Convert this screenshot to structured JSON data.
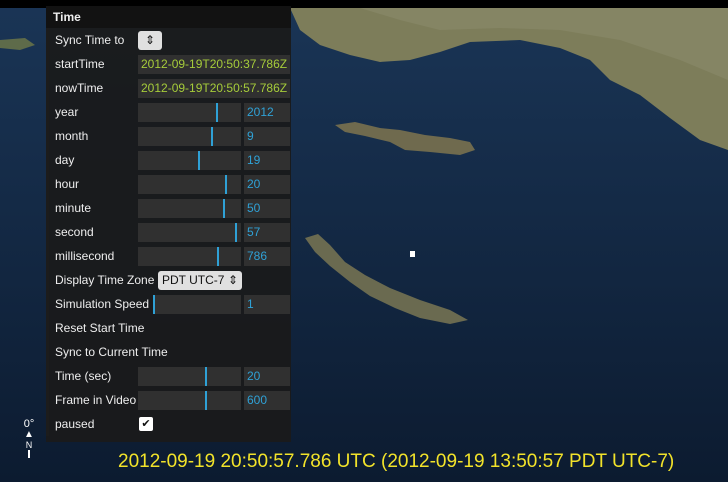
{
  "panel": {
    "title": "Time",
    "sync_time_label": "Sync Time to",
    "start_time": {
      "label": "startTime",
      "value": "2012-09-19T20:50:37.786Z"
    },
    "now_time": {
      "label": "nowTime",
      "value": "2012-09-19T20:50:57.786Z"
    },
    "sliders": [
      {
        "key": "year",
        "label": "year",
        "value": "2012",
        "level": 0.77
      },
      {
        "key": "month",
        "label": "month",
        "value": "9",
        "level": 0.72
      },
      {
        "key": "day",
        "label": "day",
        "value": "19",
        "level": 0.59
      },
      {
        "key": "hour",
        "label": "hour",
        "value": "20",
        "level": 0.86
      },
      {
        "key": "minute",
        "label": "minute",
        "value": "50",
        "level": 0.84
      },
      {
        "key": "second",
        "label": "second",
        "value": "57",
        "level": 0.96
      },
      {
        "key": "millisecond",
        "label": "millisecond",
        "value": "786",
        "level": 0.78
      }
    ],
    "display_time_zone": {
      "label": "Display Time Zone",
      "value": "PDT UTC-7"
    },
    "simulation_speed": {
      "label": "Simulation Speed",
      "value": "1",
      "level": 0.0
    },
    "reset_start_time": "Reset Start Time",
    "sync_current_time": "Sync to Current Time",
    "time_sec": {
      "label": "Time (sec)",
      "value": "20",
      "level": 0.66
    },
    "frame_in_video": {
      "label": "Frame in Video",
      "value": "600",
      "level": 0.66
    },
    "paused": {
      "label": "paused",
      "checked": true
    }
  },
  "status_text": "2012-09-19 20:50:57.786 UTC  (2012-09-19 13:50:57 PDT UTC-7)",
  "compass": {
    "heading": "0°",
    "north": "N"
  },
  "colors": {
    "accent": "#2fa1d6",
    "text_value": "#a6cc3a",
    "status": "#f2e32a"
  }
}
